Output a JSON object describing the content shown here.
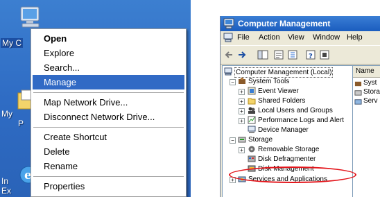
{
  "desktop": {
    "icons": [
      {
        "label": "My C",
        "icon": "my-computer-icon"
      },
      {
        "label": "My",
        "icon": "my-documents-icon",
        "label2": "P"
      },
      {
        "label": "In",
        "icon": "internet-explorer-icon",
        "label2": "Ex"
      }
    ]
  },
  "context_menu": {
    "items": [
      {
        "label": "Open",
        "bold": true
      },
      {
        "label": "Explore"
      },
      {
        "label": "Search..."
      },
      {
        "label": "Manage",
        "selected": true
      },
      {
        "label": "Map Network Drive..."
      },
      {
        "label": "Disconnect Network Drive..."
      },
      {
        "label": "Create Shortcut"
      },
      {
        "label": "Delete"
      },
      {
        "label": "Rename"
      },
      {
        "label": "Properties"
      }
    ]
  },
  "window": {
    "title": "Computer Management",
    "menu": [
      "File",
      "Action",
      "View",
      "Window",
      "Help"
    ],
    "tree": {
      "root": "Computer Management (Local)",
      "system_tools": "System Tools",
      "event_viewer": "Event Viewer",
      "shared_folders": "Shared Folders",
      "local_users": "Local Users and Groups",
      "perf_logs": "Performance Logs and Alert",
      "device_manager": "Device Manager",
      "storage": "Storage",
      "removable_storage": "Removable Storage",
      "disk_defrag": "Disk Defragmenter",
      "disk_management": "Disk Management",
      "services_apps": "Services and Applications"
    },
    "list": {
      "header": "Name",
      "rows": [
        "Syst",
        "Stora",
        "Serv"
      ]
    }
  },
  "colors": {
    "desktop_bg": "#3a79cd",
    "menu_selection": "#316ac5",
    "title_bar": "#2a6bd0",
    "annotation_ring": "#e3141a"
  }
}
